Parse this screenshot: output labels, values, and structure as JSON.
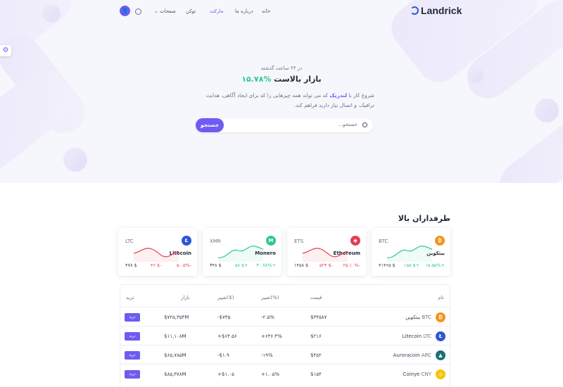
{
  "brand": {
    "name": "Landrick"
  },
  "nav": {
    "home": "خانه",
    "about": "درباره ما",
    "market": "مارکت",
    "token": "توکن",
    "pages": "صفحات"
  },
  "hero": {
    "subtitle": "در ۲۴ ساعت گذشته",
    "headline": "بازار بالاست",
    "headline_pct": "۱۵.۷۸%",
    "para_1": "شروع کار با",
    "para_brand": "لندریک",
    "para_2": "که می تواند همه چیزهایی را که برای ایجاد آگاهی، هدایت ترافیک، و اتصال نیاز دارید فراهم کند.",
    "search_placeholder": "جستجو...",
    "search_button": "جستجو"
  },
  "top_section": {
    "title": "طرفداران بالا"
  },
  "cards": [
    {
      "symbol": "BTC",
      "name": "بیتکوین",
      "price": "۴۱۴۶۵ $",
      "change": "۱۵۵ $+",
      "pct": "۱۵.۵۵%+",
      "color": "#f7931a",
      "glyph": "₿",
      "dir": "up"
    },
    {
      "symbol": "ETS",
      "name": "Ethereum",
      "price": "۱۴۵۸ $",
      "change": "۵۲۴ $-",
      "pct": "۲۵.۱۰%-",
      "color": "#e43f52",
      "glyph": "◆",
      "dir": "down"
    },
    {
      "symbol": "XMR",
      "name": "Monero",
      "price": "۳۴۸ $",
      "change": "۵۸ $+",
      "pct": "۳۰.۷۸%+",
      "color": "#2eca8b",
      "glyph": "M",
      "dir": "up"
    },
    {
      "symbol": "LTC",
      "name": "Litecoin",
      "price": "۴۷۸ $",
      "change": "۴۶ $-",
      "pct": "۵.۰۵%-",
      "color": "#2f55d4",
      "glyph": "Ł",
      "dir": "down"
    }
  ],
  "table": {
    "headers": {
      "name": "نام",
      "price": "قیمت",
      "change_pct": "تغییر(%)",
      "change_usd": "تغییر($)",
      "market": "بازار",
      "trade": "ترید"
    },
    "rows": [
      {
        "name": "بیتکوین",
        "sym": "BTC",
        "price": "$۳۴۵۸۷",
        "pct": "-۲.۵%",
        "usd": "-$۷۴۵",
        "market": "$۷۲۵,۳۵۴M",
        "dir": "down",
        "color": "#f7931a",
        "glyph": "₿",
        "trade": "ترید"
      },
      {
        "name": "Litecoin",
        "sym": "LTC",
        "price": "$۲۱۶",
        "pct": "+۶۳۶.۴%",
        "usd": "+$۶۴.۵۶",
        "market": "$۱۱,۱۰۸M",
        "dir": "up",
        "color": "#2f55d4",
        "glyph": "Ł",
        "trade": "ترید"
      },
      {
        "name": "Auroracoin",
        "sym": "ARC",
        "price": "$۴۵۲",
        "pct": "-۱۹%",
        "usd": "-$۱.۹",
        "market": "$۶۵,۷۸۵M",
        "dir": "down",
        "color": "#1f6f72",
        "glyph": "▲",
        "trade": "ترید"
      },
      {
        "name": "Coinye",
        "sym": "CNY",
        "price": "$۱۵۴",
        "pct": "+۱.۰۵%",
        "usd": "+$۱.۰۵",
        "market": "$۸۵,۳۷۸M",
        "dir": "up",
        "color": "#f5c400",
        "glyph": "◎",
        "trade": "ترید"
      }
    ]
  }
}
